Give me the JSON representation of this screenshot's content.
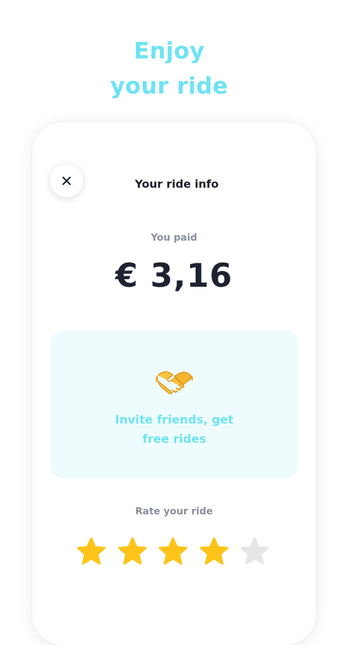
{
  "headline": {
    "line1": "Enjoy",
    "line2": "your ride"
  },
  "card": {
    "title": "Your ride info",
    "paid_label": "You paid",
    "paid_amount": "€ 3,16",
    "invite": {
      "icon": "handshake-icon",
      "line1": "Invite friends, get",
      "line2": "free rides"
    },
    "rating": {
      "label": "Rate your ride",
      "value": 4,
      "max": 5
    }
  },
  "colors": {
    "accent": "#6fe3f2",
    "star_filled": "#fcc419",
    "star_empty": "#e6e6e6",
    "invite_bg": "#eefcfd"
  }
}
